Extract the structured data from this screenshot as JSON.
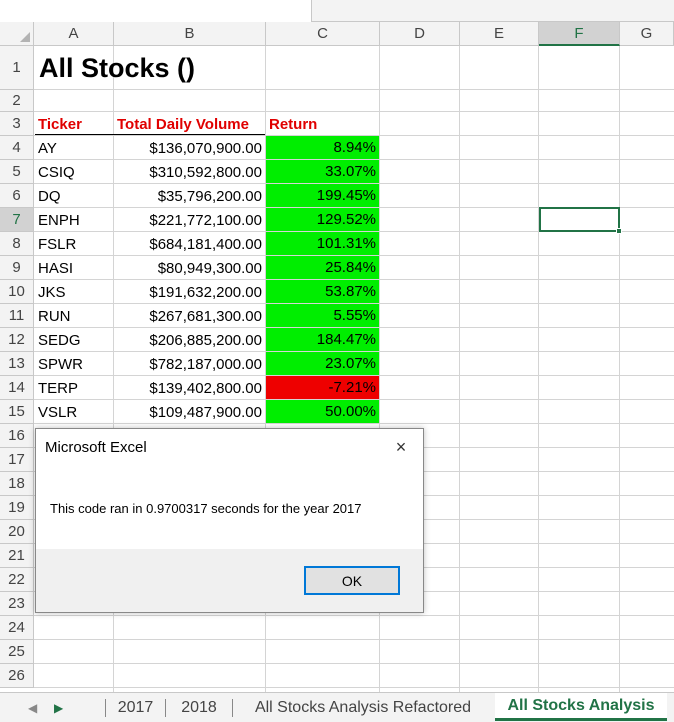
{
  "columns": [
    "A",
    "B",
    "C",
    "D",
    "E",
    "F",
    "G"
  ],
  "active_column": "F",
  "rows": [
    "1",
    "2",
    "3",
    "4",
    "5",
    "6",
    "7",
    "8",
    "9",
    "10",
    "11",
    "12",
    "13",
    "14",
    "15",
    "16",
    "17",
    "18",
    "19",
    "20",
    "21",
    "22",
    "23",
    "24",
    "25",
    "26"
  ],
  "active_row": "7",
  "title": "All Stocks ()",
  "headers": {
    "ticker": "Ticker",
    "volume": "Total Daily Volume",
    "return": "Return"
  },
  "stocks": [
    {
      "ticker": "AY",
      "volume": "$136,070,900.00",
      "return": "8.94%",
      "positive": true
    },
    {
      "ticker": "CSIQ",
      "volume": "$310,592,800.00",
      "return": "33.07%",
      "positive": true
    },
    {
      "ticker": "DQ",
      "volume": "$35,796,200.00",
      "return": "199.45%",
      "positive": true
    },
    {
      "ticker": "ENPH",
      "volume": "$221,772,100.00",
      "return": "129.52%",
      "positive": true
    },
    {
      "ticker": "FSLR",
      "volume": "$684,181,400.00",
      "return": "101.31%",
      "positive": true
    },
    {
      "ticker": "HASI",
      "volume": "$80,949,300.00",
      "return": "25.84%",
      "positive": true
    },
    {
      "ticker": "JKS",
      "volume": "$191,632,200.00",
      "return": "53.87%",
      "positive": true
    },
    {
      "ticker": "RUN",
      "volume": "$267,681,300.00",
      "return": "5.55%",
      "positive": true
    },
    {
      "ticker": "SEDG",
      "volume": "$206,885,200.00",
      "return": "184.47%",
      "positive": true
    },
    {
      "ticker": "SPWR",
      "volume": "$782,187,000.00",
      "return": "23.07%",
      "positive": true
    },
    {
      "ticker": "TERP",
      "volume": "$139,402,800.00",
      "return": "-7.21%",
      "positive": false
    },
    {
      "ticker": "VSLR",
      "volume": "$109,487,900.00",
      "return": "50.00%",
      "positive": true
    }
  ],
  "tabs": [
    {
      "label": "2017",
      "active": false
    },
    {
      "label": "2018",
      "active": false
    },
    {
      "label": "All Stocks Analysis Refactored",
      "active": false
    },
    {
      "label": "All Stocks Analysis",
      "active": true
    }
  ],
  "dialog": {
    "title": "Microsoft Excel",
    "close_icon": "×",
    "message": "This code ran in 0.9700317 seconds for the year 2017",
    "ok_label": "OK"
  },
  "colors": {
    "positive": "#00ee00",
    "negative": "#ee0000",
    "header_text": "#e00000",
    "accent": "#217346",
    "dialog_button_border": "#0078d7"
  }
}
